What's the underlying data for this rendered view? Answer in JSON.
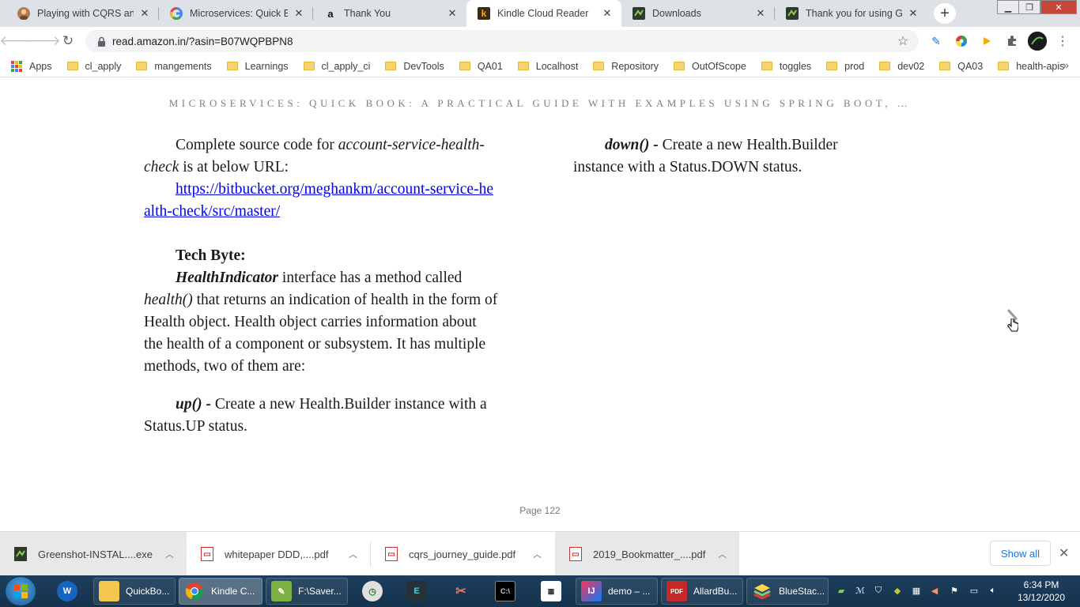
{
  "browser": {
    "tabs": [
      {
        "title": "Playing with CQRS and E",
        "favicon": "avatar-icon",
        "active": false
      },
      {
        "title": "Microservices: Quick Boo",
        "favicon": "google-icon",
        "active": false
      },
      {
        "title": "Thank You",
        "favicon": "amazon-icon",
        "active": false
      },
      {
        "title": "Kindle Cloud Reader",
        "favicon": "kindle-icon",
        "active": true
      },
      {
        "title": "Downloads",
        "favicon": "greenshot-icon",
        "active": false
      },
      {
        "title": "Thank you for using Gre",
        "favicon": "greenshot-icon",
        "active": false
      }
    ],
    "url": "read.amazon.in/?asin=B07WQPBPN8",
    "bookmarks": [
      "Apps",
      "cl_apply",
      "mangements",
      "Learnings",
      "cl_apply_ci",
      "DevTools",
      "QA01",
      "Localhost",
      "Repository",
      "OutOfScope",
      "toggles",
      "prod",
      "dev02",
      "QA03",
      "health-apis"
    ]
  },
  "reader": {
    "book_title": "MICROSERVICES: QUICK BOOK: A PRACTICAL GUIDE WITH EXAMPLES USING SPRING BOOT, …",
    "left_column": {
      "p1_prefix": "Complete source code for ",
      "p1_italic": "account-service-health-check",
      "p1_suffix": " is at below URL:",
      "link": "https://bitbucket.org/meghankm/account-service-health-check/src/master/",
      "tech_byte_heading": "Tech Byte:",
      "p2_bold_italic": "HealthIndicator",
      "p2_text1": " interface has a method called ",
      "p2_italic": "health()",
      "p2_text2": " that returns an indication of health in the form of Health object. Health object carries information about the health of a component or subsystem. It has multiple methods, two of them are:",
      "p3_method": "up() -",
      "p3_text": " Create a new Health.Builder instance with a Status.UP status."
    },
    "right_column": {
      "method": "down() -",
      "text": " Create a new Health.Builder instance with a Status.DOWN status."
    },
    "page_number": "Page 122"
  },
  "downloads": {
    "items": [
      {
        "name": "Greenshot-INSTAL....exe",
        "type": "exe"
      },
      {
        "name": "whitepaper DDD,....pdf",
        "type": "pdf"
      },
      {
        "name": "cqrs_journey_guide.pdf",
        "type": "pdf"
      },
      {
        "name": "2019_Bookmatter_....pdf",
        "type": "pdf"
      }
    ],
    "show_all": "Show all"
  },
  "taskbar": {
    "items": [
      {
        "label": "QuickBo..."
      },
      {
        "label": "Kindle C..."
      },
      {
        "label": "F:\\Saver..."
      },
      {
        "label": "demo – ..."
      },
      {
        "label": "AllardBu..."
      },
      {
        "label": "BlueStac..."
      }
    ],
    "time": "6:34 PM",
    "date": "13/12/2020"
  },
  "colors": {
    "link": "#0000ee",
    "tabstrip": "#dee1e6",
    "taskbar": "#14324c",
    "show_all": "#1a73e8"
  }
}
